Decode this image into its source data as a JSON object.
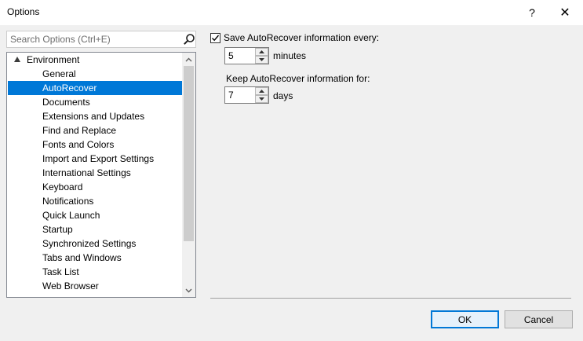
{
  "window": {
    "title": "Options",
    "help_label": "?",
    "close_label": "✕"
  },
  "search": {
    "placeholder": "Search Options (Ctrl+E)"
  },
  "tree": {
    "root_label": "Environment",
    "items": [
      {
        "label": "General"
      },
      {
        "label": "AutoRecover"
      },
      {
        "label": "Documents"
      },
      {
        "label": "Extensions and Updates"
      },
      {
        "label": "Find and Replace"
      },
      {
        "label": "Fonts and Colors"
      },
      {
        "label": "Import and Export Settings"
      },
      {
        "label": "International Settings"
      },
      {
        "label": "Keyboard"
      },
      {
        "label": "Notifications"
      },
      {
        "label": "Quick Launch"
      },
      {
        "label": "Startup"
      },
      {
        "label": "Synchronized Settings"
      },
      {
        "label": "Tabs and Windows"
      },
      {
        "label": "Task List"
      },
      {
        "label": "Web Browser"
      }
    ],
    "selected_label": "AutoRecover"
  },
  "autorecover": {
    "save_every_label": "Save AutoRecover information every:",
    "save_every_checked": true,
    "minutes_value": "5",
    "minutes_unit": "minutes",
    "keep_for_label": "Keep AutoRecover information for:",
    "days_value": "7",
    "days_unit": "days"
  },
  "footer": {
    "ok_label": "OK",
    "cancel_label": "Cancel"
  },
  "colors": {
    "selection": "#0078d7",
    "dialog_bg": "#f0f0f0"
  }
}
